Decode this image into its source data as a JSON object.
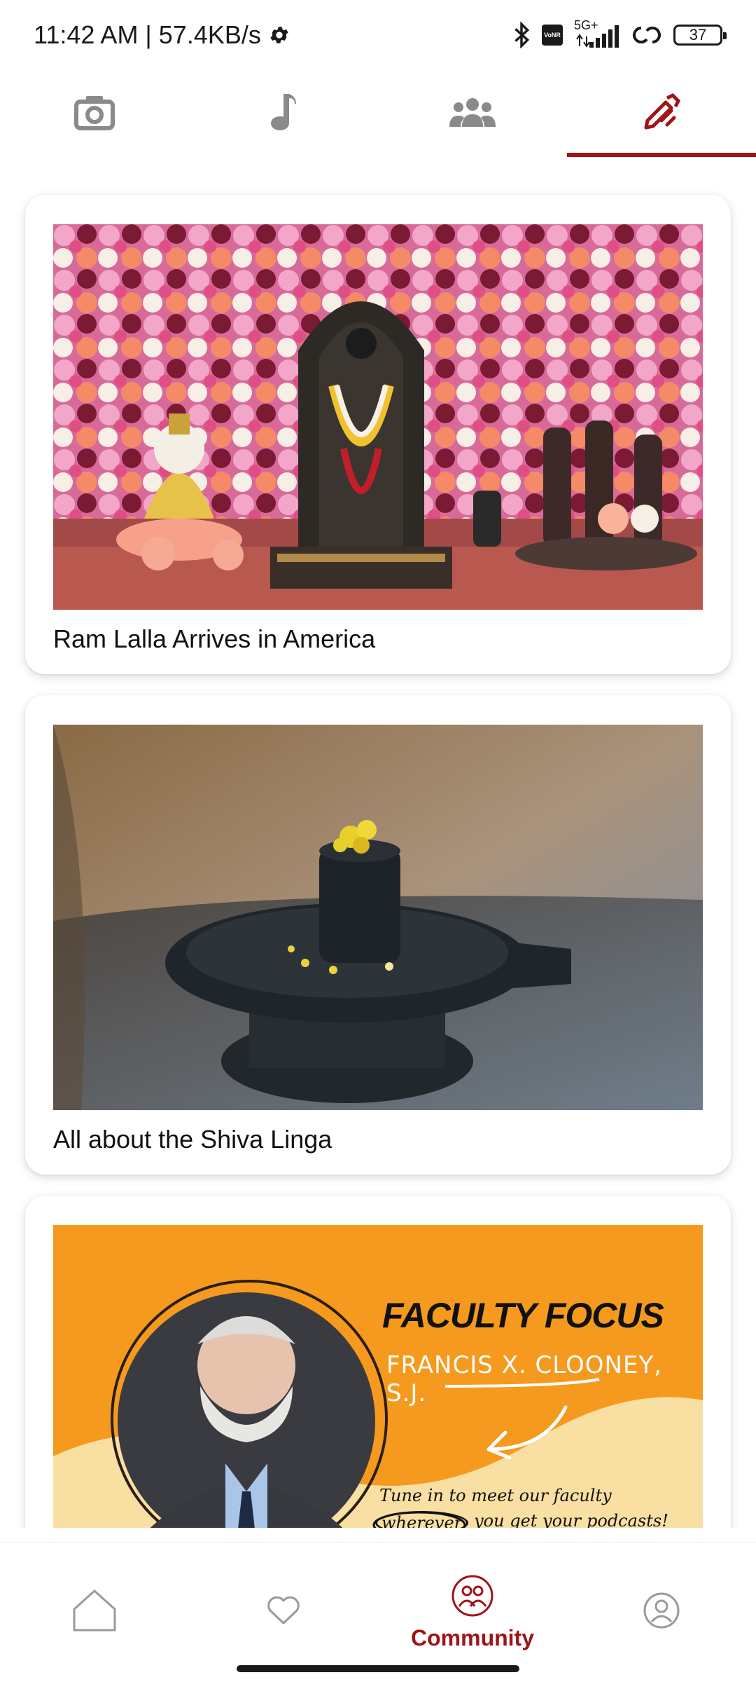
{
  "status_bar": {
    "time_speed": "11:42 AM | 57.4KB/s",
    "network": "5G+",
    "volte": "VoNR",
    "battery": "37",
    "icons": [
      "settings-icon",
      "bluetooth-icon",
      "signal-icon",
      "data-sync-icon",
      "battery-icon"
    ]
  },
  "top_tabs": [
    {
      "icon": "camera-icon",
      "active": false
    },
    {
      "icon": "music-note-icon",
      "active": false
    },
    {
      "icon": "group-icon",
      "active": false
    },
    {
      "icon": "write-icon",
      "active": true
    }
  ],
  "feed": {
    "cards": [
      {
        "title": "Ram Lalla Arrives in America",
        "image": "ram-lalla-photo"
      },
      {
        "title": "All about the Shiva Linga",
        "image": "shiva-linga-photo"
      },
      {
        "title": "",
        "image": "faculty-focus-banner",
        "banner": {
          "heading": "FACULTY FOCUS",
          "name": "FRANCIS X. CLOONEY, S.J.",
          "line1": "Tune in to meet our faculty",
          "line2_circled": "wherever",
          "line2_rest": "you get your",
          "line2_underlined": "podcasts!"
        }
      }
    ]
  },
  "bottom_nav": {
    "items": [
      {
        "icon": "home-icon",
        "label": ""
      },
      {
        "icon": "heart-icon",
        "label": ""
      },
      {
        "icon": "community-icon",
        "label": "Community",
        "active": true
      },
      {
        "icon": "profile-icon",
        "label": ""
      }
    ]
  },
  "colors": {
    "accent": "#a01418",
    "icon_gray": "#8a8a8a",
    "banner_orange": "#f59a1e",
    "banner_cream": "#f9dfa2"
  }
}
